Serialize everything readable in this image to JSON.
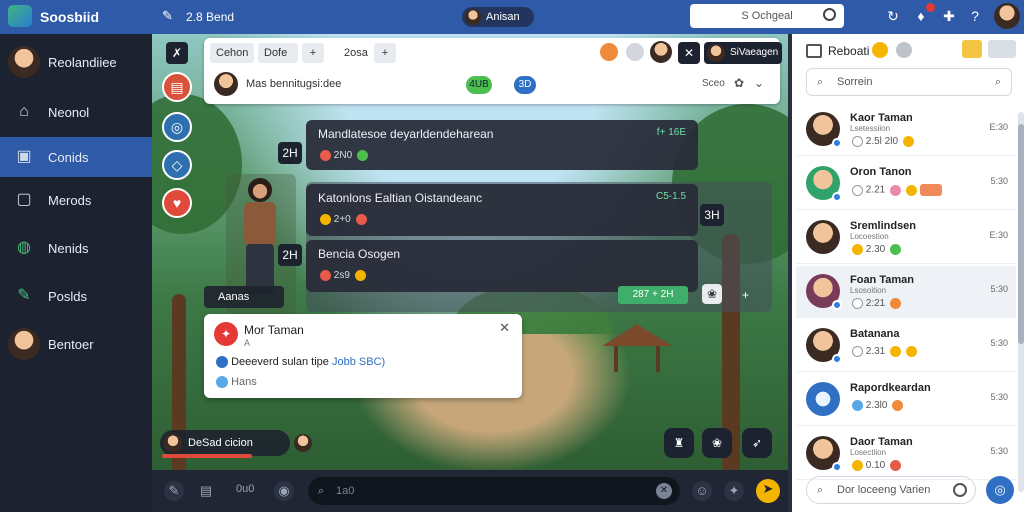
{
  "app": {
    "title": "Soosbiid",
    "status": "2.8 Bend"
  },
  "top": {
    "user_name": "Anisan",
    "search_value": "S Ochgeal"
  },
  "sidebar": {
    "profile_label": "Reolandiiee",
    "items": [
      {
        "label": "Neonol",
        "icon": "home-icon"
      },
      {
        "label": "Conids",
        "icon": "chat-icon"
      },
      {
        "label": "Merods",
        "icon": "tablet-icon"
      },
      {
        "label": "Nenids",
        "icon": "shield-icon"
      },
      {
        "label": "Poslds",
        "icon": "pencil-icon"
      }
    ],
    "footer_label": "Bentoer"
  },
  "chat_header": {
    "tabs": [
      "Cehon",
      "Dofe",
      "+"
    ],
    "sub_tab": "2osa",
    "sub_tab_plus": "+",
    "room_title": "Mas bennitugsi:dee",
    "pill_green": "4UB",
    "pill_blue": "3D",
    "zoom_label": "Sceo",
    "top_right_label": "SiVaeagen"
  },
  "messages": [
    {
      "text": "Mandlatesoe deyarldendeharean",
      "right": "f+ 16E",
      "meta": "2N0",
      "tag": "2H"
    },
    {
      "text": "Katonlons Ealtian Oistandeanc",
      "right": "C5-1.5",
      "meta": "2+0",
      "tag": "2H",
      "side": "3H"
    },
    {
      "text": "Bencia Osogen",
      "meta": "2s9",
      "tag": "2H",
      "count": "287 + 2H"
    }
  ],
  "character_label": "Aanas",
  "popup": {
    "name": "Mor Taman",
    "sub": "A",
    "line1": "Deeeverd sulan tipe",
    "line1_highlight": "Jobb SBC)",
    "line2": "Hans"
  },
  "game_bottom": {
    "label": "DeSad cicion"
  },
  "bottombar": {
    "count": "0u0",
    "input_placeholder": "1a0"
  },
  "rpanel": {
    "title": "Reboati",
    "search_placeholder": "Sorrein",
    "contacts": [
      {
        "name": "Kaor Taman",
        "sub": "Lsetessiion",
        "meta": "2.5l 2l0",
        "time": "E:30"
      },
      {
        "name": "Oron Tanon",
        "sub": "",
        "meta": "2.21",
        "time": "5:30"
      },
      {
        "name": "Sremlindsen",
        "sub": "Locoestion",
        "meta": "2.30",
        "time": "E:30"
      },
      {
        "name": "Foan Taman",
        "sub": "Lsosoition",
        "meta": "2:21",
        "time": "5:30"
      },
      {
        "name": "Batanana",
        "sub": "",
        "meta": "2.31",
        "time": "5:30"
      },
      {
        "name": "Rapordkeardan",
        "sub": "",
        "meta": "2.3l0",
        "time": "5:30"
      },
      {
        "name": "Daor Taman",
        "sub": "Losectiion",
        "meta": "0.10",
        "time": "5:30"
      }
    ],
    "bottom_placeholder": "Dor loceeng Varien"
  },
  "colors": {
    "accent": "#2f5aa8",
    "sidebar": "#1d2230",
    "panel": "#ffffff"
  }
}
